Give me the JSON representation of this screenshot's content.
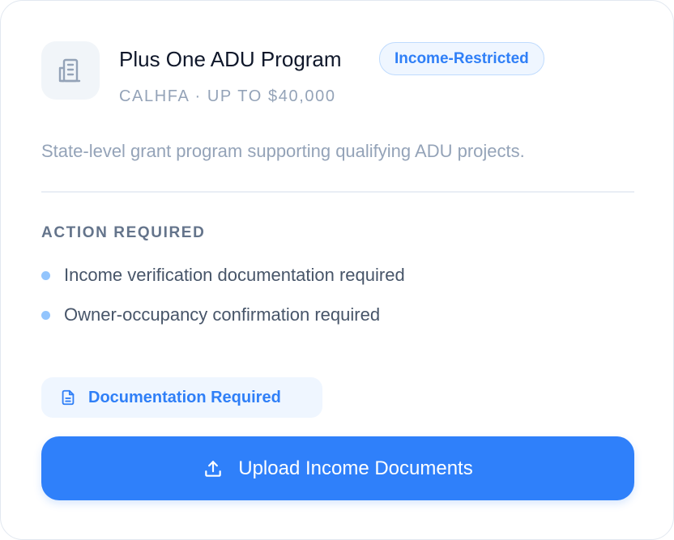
{
  "program": {
    "icon": "building-icon",
    "title": "Plus One ADU Program",
    "badge": "Income-Restricted",
    "subtitle": "CALHFA · UP TO $40,000",
    "description": "State-level grant program supporting qualifying ADU projects."
  },
  "action": {
    "label": "ACTION REQUIRED",
    "items": [
      "Income verification documentation required",
      "Owner-occupancy confirmation required"
    ]
  },
  "status_pill": {
    "icon": "document-icon",
    "label": "Documentation Required"
  },
  "upload_button": {
    "icon": "upload-icon",
    "label": "Upload Income Documents"
  },
  "colors": {
    "accent": "#2f80fa",
    "badge_bg": "#eff6ff",
    "title": "#0f172a",
    "muted": "#94a3b8"
  }
}
